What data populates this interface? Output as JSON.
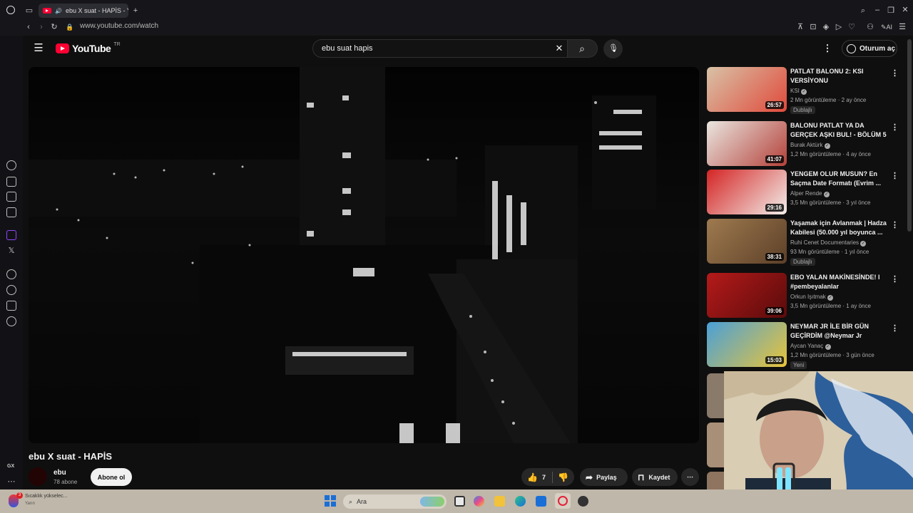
{
  "browser": {
    "tab_title": "ebu X suat - HAPİS - Y",
    "url": "www.youtube.com/watch",
    "ai_label": "AI",
    "gx_label": "GX"
  },
  "header": {
    "logo_text": "YouTube",
    "region": "TR",
    "search_value": "ebu suat hapis",
    "signin_label": "Oturum aç"
  },
  "video": {
    "title": "ebu X suat - HAPİS",
    "channel": "ebu",
    "subscribers": "78 abone",
    "subscribe_label": "Abone ol",
    "likes": "7",
    "share_label": "Paylaş",
    "save_label": "Kaydet"
  },
  "recommendations": [
    {
      "title": "PATLAT BALONU 2: KSI VERSİYONU",
      "channel": "KSI",
      "meta": "2 Mn görüntüleme · 2 ay önce",
      "duration": "26:57",
      "badge": "Dublajlı",
      "colors": [
        "#d8c2a6",
        "#e04a3c"
      ]
    },
    {
      "title": "BALONU PATLAT YA DA GERÇEK AŞKI BUL! - BÖLÜM 5",
      "channel": "Burak Aktürk",
      "meta": "1,2 Mn görüntüleme · 4 ay önce",
      "duration": "41:07",
      "badge": "",
      "colors": [
        "#eae6e0",
        "#b4413a"
      ]
    },
    {
      "title": "YENGEM OLUR MUSUN? En Saçma Date Formatı (Evrim ...",
      "channel": "Alper Rende",
      "meta": "3,5 Mn görüntüleme · 3 yıl önce",
      "duration": "29:16",
      "badge": "",
      "colors": [
        "#d42424",
        "#f2efea"
      ]
    },
    {
      "title": "Yaşamak için Avlanmak | Hadza Kabilesi (50.000 yıl boyunca ...",
      "channel": "Ruhi Cenet Documentaries",
      "meta": "93 Mn görüntüleme · 1 yıl önce",
      "duration": "38:31",
      "badge": "Dublajlı",
      "colors": [
        "#9e7a4f",
        "#5d4028"
      ]
    },
    {
      "title": "EBO YALAN MAKİNESİNDE! l #pembeyalanlar",
      "channel": "Orkun Işıtmak",
      "meta": "3,5 Mn görüntüleme · 1 ay önce",
      "duration": "39:06",
      "badge": "",
      "colors": [
        "#b51a1a",
        "#5a0b0b"
      ]
    },
    {
      "title": "NEYMAR JR İLE BİR GÜN GEÇİRDİM @Neymar Jr",
      "channel": "Aycan Yanaç",
      "meta": "1,2 Mn görüntüleme · 3 gün önce",
      "duration": "15:03",
      "badge": "Yeni",
      "colors": [
        "#4aa0d8",
        "#e8c43a"
      ]
    }
  ],
  "taskbar": {
    "search_placeholder": "Ara",
    "weather_text": "Sıcaklık yükselec...",
    "weather_sub": "Yarın",
    "weather_badge": "3"
  }
}
